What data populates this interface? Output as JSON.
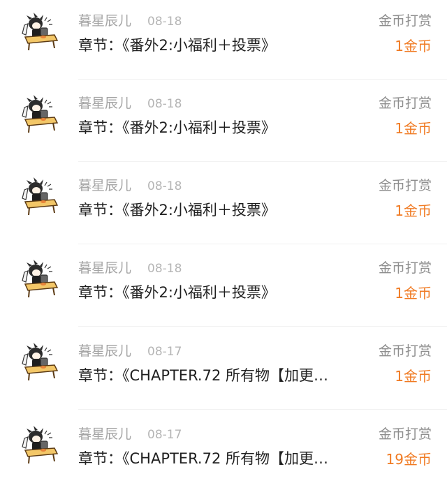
{
  "rows": [
    {
      "user": "暮星辰儿",
      "date": "08-18",
      "type_label": "金币打赏",
      "chapter": "章节：《番外2:小福利＋投票》",
      "amount": "1金币"
    },
    {
      "user": "暮星辰儿",
      "date": "08-18",
      "type_label": "金币打赏",
      "chapter": "章节：《番外2:小福利＋投票》",
      "amount": "1金币"
    },
    {
      "user": "暮星辰儿",
      "date": "08-18",
      "type_label": "金币打赏",
      "chapter": "章节：《番外2:小福利＋投票》",
      "amount": "1金币"
    },
    {
      "user": "暮星辰儿",
      "date": "08-18",
      "type_label": "金币打赏",
      "chapter": "章节：《番外2:小福利＋投票》",
      "amount": "1金币"
    },
    {
      "user": "暮星辰儿",
      "date": "08-17",
      "type_label": "金币打赏",
      "chapter": "章节：《CHAPTER.72 所有物【加更…",
      "amount": "1金币"
    },
    {
      "user": "暮星辰儿",
      "date": "08-17",
      "type_label": "金币打赏",
      "chapter": "章节：《CHAPTER.72 所有物【加更…",
      "amount": "19金币"
    }
  ],
  "colors": {
    "amount": "#f07a22",
    "secondary_text": "#a5a5a5",
    "primary_text": "#1f1f1f"
  }
}
